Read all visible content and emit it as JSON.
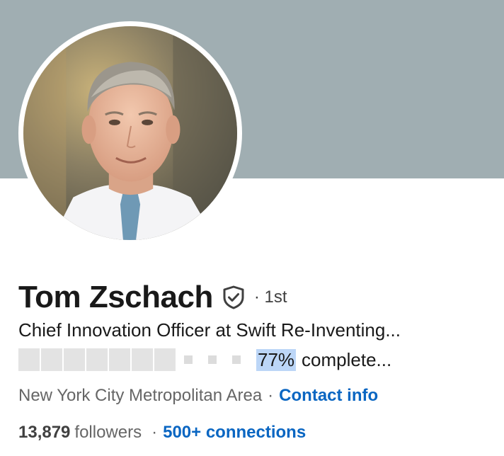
{
  "colors": {
    "banner": "#a0aeb2",
    "link": "#0a66c2",
    "highlight": "#bcd6f7"
  },
  "profile": {
    "name": "Tom Zschach",
    "verified_icon": "shield-check-icon",
    "degree": "· 1st",
    "headline": "Chief Innovation Officer at Swift Re-Inventing...",
    "completion": {
      "percent": "77%",
      "label": "complete..."
    },
    "location": "New York City Metropolitan Area",
    "separator": "·",
    "contact_info": "Contact info",
    "followers_count": "13,879",
    "followers_label": "followers",
    "connections": "500+ connections"
  }
}
